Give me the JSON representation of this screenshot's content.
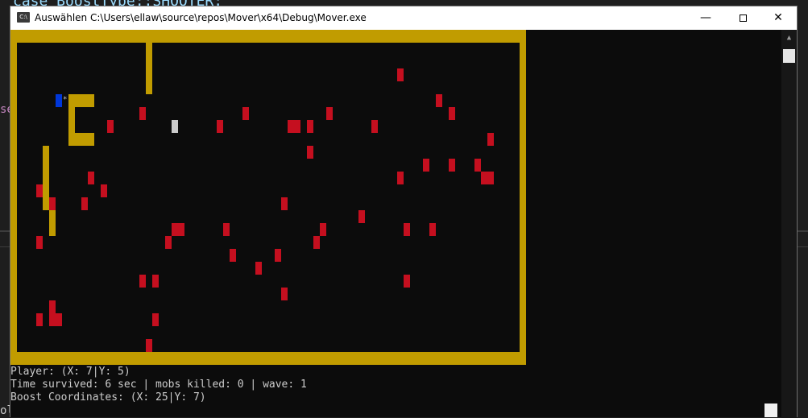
{
  "ide": {
    "code_line": "case BoostType::SHOOTER:",
    "fragment_left": "se",
    "fragment_bottom": "ol"
  },
  "window": {
    "title": "Auswählen C:\\Users\\ellaw\\source\\repos\\Mover\\x64\\Debug\\Mover.exe",
    "icon_text": "C:\\",
    "minimize_label": "—",
    "close_label": "✕",
    "scroll_up_label": "▲"
  },
  "game": {
    "grid": {
      "cols": 80,
      "rows": 26
    },
    "colors": {
      "background": "#0c0c0c",
      "wall": "#c19c00",
      "mob": "#c50f1f",
      "player": "#0037da",
      "boost": "#cccccc"
    },
    "player": {
      "x": 7,
      "y": 5,
      "char": "*"
    },
    "boost": {
      "x": 25,
      "y": 7
    },
    "inner_walls": [
      {
        "x": 21,
        "y": 1,
        "w": 1,
        "h": 4
      },
      {
        "x": 9,
        "y": 5,
        "w": 4,
        "h": 1
      },
      {
        "x": 9,
        "y": 6,
        "w": 1,
        "h": 2
      },
      {
        "x": 9,
        "y": 8,
        "w": 4,
        "h": 1
      },
      {
        "x": 5,
        "y": 9,
        "w": 1,
        "h": 5
      },
      {
        "x": 6,
        "y": 13,
        "w": 1,
        "h": 3
      }
    ],
    "mobs": [
      [
        60,
        3
      ],
      [
        66,
        5
      ],
      [
        68,
        6
      ],
      [
        20,
        6
      ],
      [
        36,
        6
      ],
      [
        49,
        6
      ],
      [
        15,
        7
      ],
      [
        32,
        7
      ],
      [
        43,
        7
      ],
      [
        44,
        7
      ],
      [
        46,
        7
      ],
      [
        56,
        7
      ],
      [
        74,
        8
      ],
      [
        46,
        9
      ],
      [
        64,
        10
      ],
      [
        68,
        10
      ],
      [
        72,
        10
      ],
      [
        12,
        11
      ],
      [
        60,
        11
      ],
      [
        73,
        11
      ],
      [
        74,
        11
      ],
      [
        4,
        12
      ],
      [
        14,
        12
      ],
      [
        6,
        13
      ],
      [
        11,
        13
      ],
      [
        42,
        13
      ],
      [
        54,
        14
      ],
      [
        25,
        15
      ],
      [
        26,
        15
      ],
      [
        33,
        15
      ],
      [
        48,
        15
      ],
      [
        61,
        15
      ],
      [
        65,
        15
      ],
      [
        4,
        16
      ],
      [
        24,
        16
      ],
      [
        47,
        16
      ],
      [
        34,
        17
      ],
      [
        41,
        17
      ],
      [
        38,
        18
      ],
      [
        20,
        19
      ],
      [
        22,
        19
      ],
      [
        61,
        19
      ],
      [
        42,
        20
      ],
      [
        6,
        21
      ],
      [
        4,
        22
      ],
      [
        6,
        22
      ],
      [
        7,
        22
      ],
      [
        22,
        22
      ],
      [
        21,
        24
      ]
    ]
  },
  "status": {
    "player_line": "Player: (X: 7|Y: 5)",
    "time_line": "Time survived: 6 sec | mobs killed: 0 | wave: 1",
    "boost_line": "Boost Coordinates: (X: 25|Y: 7)"
  }
}
